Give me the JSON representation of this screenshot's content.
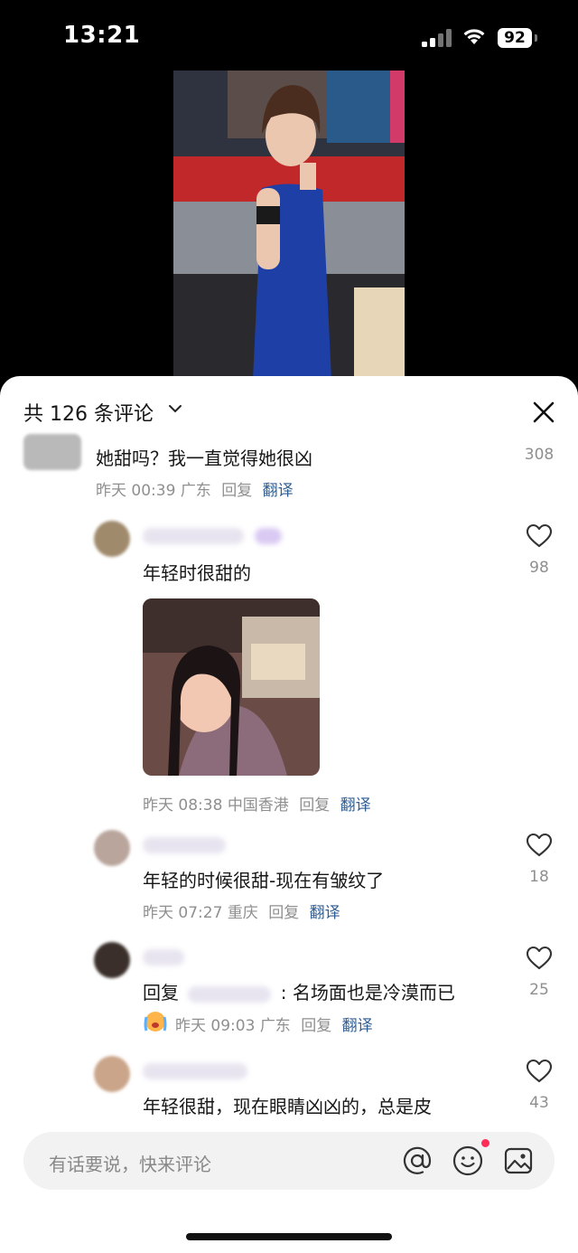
{
  "status_bar": {
    "time": "13:21",
    "battery": "92"
  },
  "sheet": {
    "header": {
      "title": "共 126 条评论",
      "chevron_icon": "chevron-down-icon",
      "close_icon": "close-icon"
    },
    "comments": [
      {
        "text": "她甜吗？我一直觉得她很凶",
        "time": "昨天 00:39",
        "location": "广东",
        "reply": "回复",
        "translate": "翻译",
        "likes": "308"
      },
      {
        "text": "年轻时很甜的",
        "time": "昨天 08:38",
        "location": "中国香港",
        "reply": "回复",
        "translate": "翻译",
        "likes": "98"
      },
      {
        "text": "年轻的时候很甜-现在有皱纹了",
        "time": "昨天 07:27",
        "location": "重庆",
        "reply": "回复",
        "translate": "翻译",
        "likes": "18"
      },
      {
        "text_prefix": "回复",
        "text_suffix": ": 名场面也是冷漠而已",
        "time": "昨天 09:03",
        "location": "广东",
        "reply": "回复",
        "translate": "翻译",
        "likes": "25",
        "emoji": "crying-face"
      },
      {
        "text": "年轻很甜，现在眼睛凶凶的，总是皮",
        "likes": "43"
      }
    ]
  },
  "input": {
    "placeholder": "有话要说，快来评论",
    "icons": [
      "at-icon",
      "emoji-icon",
      "image-icon"
    ]
  },
  "colors": {
    "translate_link": "#2e5d94",
    "accent_dot": "#ff2d55",
    "muted_text": "#8f8f8f"
  }
}
